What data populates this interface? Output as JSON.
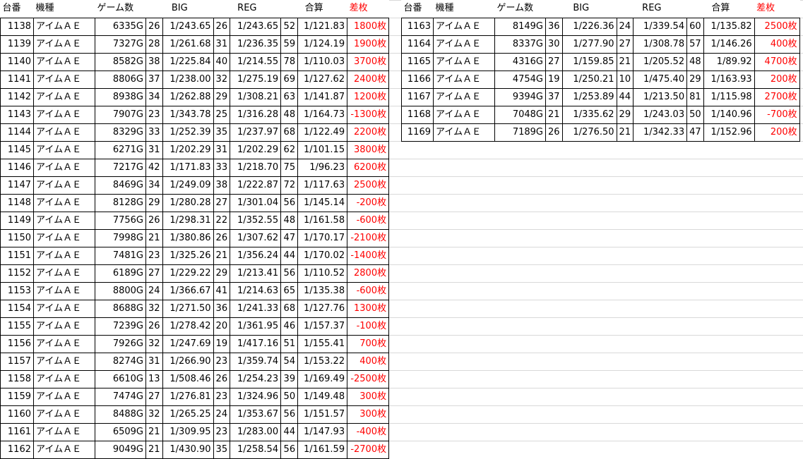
{
  "headers": [
    "台番",
    "機種",
    "ゲーム数",
    "BIG",
    "REG",
    "合算",
    "差枚"
  ],
  "left_rows": [
    [
      "1138",
      "アイムＡＥ",
      "6335G",
      "26",
      "1/243.65",
      "26",
      "1/243.65",
      "52",
      "1/121.83",
      "1800枚"
    ],
    [
      "1139",
      "アイムＡＥ",
      "7327G",
      "28",
      "1/261.68",
      "31",
      "1/236.35",
      "59",
      "1/124.19",
      "1900枚"
    ],
    [
      "1140",
      "アイムＡＥ",
      "8582G",
      "38",
      "1/225.84",
      "40",
      "1/214.55",
      "78",
      "1/110.03",
      "3700枚"
    ],
    [
      "1141",
      "アイムＡＥ",
      "8806G",
      "37",
      "1/238.00",
      "32",
      "1/275.19",
      "69",
      "1/127.62",
      "2400枚"
    ],
    [
      "1142",
      "アイムＡＥ",
      "8938G",
      "34",
      "1/262.88",
      "29",
      "1/308.21",
      "63",
      "1/141.87",
      "1200枚"
    ],
    [
      "1143",
      "アイムＡＥ",
      "7907G",
      "23",
      "1/343.78",
      "25",
      "1/316.28",
      "48",
      "1/164.73",
      "-1300枚"
    ],
    [
      "1144",
      "アイムＡＥ",
      "8329G",
      "33",
      "1/252.39",
      "35",
      "1/237.97",
      "68",
      "1/122.49",
      "2200枚"
    ],
    [
      "1145",
      "アイムＡＥ",
      "6271G",
      "31",
      "1/202.29",
      "31",
      "1/202.29",
      "62",
      "1/101.15",
      "3800枚"
    ],
    [
      "1146",
      "アイムＡＥ",
      "7217G",
      "42",
      "1/171.83",
      "33",
      "1/218.70",
      "75",
      "1/96.23",
      "6200枚"
    ],
    [
      "1147",
      "アイムＡＥ",
      "8469G",
      "34",
      "1/249.09",
      "38",
      "1/222.87",
      "72",
      "1/117.63",
      "2500枚"
    ],
    [
      "1148",
      "アイムＡＥ",
      "8128G",
      "29",
      "1/280.28",
      "27",
      "1/301.04",
      "56",
      "1/145.14",
      "-200枚"
    ],
    [
      "1149",
      "アイムＡＥ",
      "7756G",
      "26",
      "1/298.31",
      "22",
      "1/352.55",
      "48",
      "1/161.58",
      "-600枚"
    ],
    [
      "1150",
      "アイムＡＥ",
      "7998G",
      "21",
      "1/380.86",
      "26",
      "1/307.62",
      "47",
      "1/170.17",
      "-2100枚"
    ],
    [
      "1151",
      "アイムＡＥ",
      "7481G",
      "23",
      "1/325.26",
      "21",
      "1/356.24",
      "44",
      "1/170.02",
      "-1400枚"
    ],
    [
      "1152",
      "アイムＡＥ",
      "6189G",
      "27",
      "1/229.22",
      "29",
      "1/213.41",
      "56",
      "1/110.52",
      "2800枚"
    ],
    [
      "1153",
      "アイムＡＥ",
      "8800G",
      "24",
      "1/366.67",
      "41",
      "1/214.63",
      "65",
      "1/135.38",
      "-600枚"
    ],
    [
      "1154",
      "アイムＡＥ",
      "8688G",
      "32",
      "1/271.50",
      "36",
      "1/241.33",
      "68",
      "1/127.76",
      "1300枚"
    ],
    [
      "1155",
      "アイムＡＥ",
      "7239G",
      "26",
      "1/278.42",
      "20",
      "1/361.95",
      "46",
      "1/157.37",
      "-100枚"
    ],
    [
      "1156",
      "アイムＡＥ",
      "7926G",
      "32",
      "1/247.69",
      "19",
      "1/417.16",
      "51",
      "1/155.41",
      "700枚"
    ],
    [
      "1157",
      "アイムＡＥ",
      "8274G",
      "31",
      "1/266.90",
      "23",
      "1/359.74",
      "54",
      "1/153.22",
      "400枚"
    ],
    [
      "1158",
      "アイムＡＥ",
      "6610G",
      "13",
      "1/508.46",
      "26",
      "1/254.23",
      "39",
      "1/169.49",
      "-2500枚"
    ],
    [
      "1159",
      "アイムＡＥ",
      "7474G",
      "27",
      "1/276.81",
      "23",
      "1/324.96",
      "50",
      "1/149.48",
      "300枚"
    ],
    [
      "1160",
      "アイムＡＥ",
      "8488G",
      "32",
      "1/265.25",
      "24",
      "1/353.67",
      "56",
      "1/151.57",
      "300枚"
    ],
    [
      "1161",
      "アイムＡＥ",
      "6509G",
      "21",
      "1/309.95",
      "23",
      "1/283.00",
      "44",
      "1/147.93",
      "-400枚"
    ],
    [
      "1162",
      "アイムＡＥ",
      "9049G",
      "21",
      "1/430.90",
      "35",
      "1/258.54",
      "56",
      "1/161.59",
      "-2700枚"
    ]
  ],
  "right_rows": [
    [
      "1163",
      "アイムＡＥ",
      "8149G",
      "36",
      "1/226.36",
      "24",
      "1/339.54",
      "60",
      "1/135.82",
      "2500枚"
    ],
    [
      "1164",
      "アイムＡＥ",
      "8337G",
      "30",
      "1/277.90",
      "27",
      "1/308.78",
      "57",
      "1/146.26",
      "400枚"
    ],
    [
      "1165",
      "アイムＡＥ",
      "4316G",
      "27",
      "1/159.85",
      "21",
      "1/205.52",
      "48",
      "1/89.92",
      "4700枚"
    ],
    [
      "1166",
      "アイムＡＥ",
      "4754G",
      "19",
      "1/250.21",
      "10",
      "1/475.40",
      "29",
      "1/163.93",
      "200枚"
    ],
    [
      "1167",
      "アイムＡＥ",
      "9394G",
      "37",
      "1/253.89",
      "44",
      "1/213.50",
      "81",
      "1/115.98",
      "2700枚"
    ],
    [
      "1168",
      "アイムＡＥ",
      "7048G",
      "21",
      "1/335.62",
      "29",
      "1/243.03",
      "50",
      "1/140.96",
      "-700枚"
    ],
    [
      "1169",
      "アイムＡＥ",
      "7189G",
      "26",
      "1/276.50",
      "21",
      "1/342.33",
      "47",
      "1/152.96",
      "200枚"
    ]
  ],
  "colors": {
    "diff_text": "#ff0000",
    "grid": "#d9d9d9",
    "border": "#000000"
  }
}
